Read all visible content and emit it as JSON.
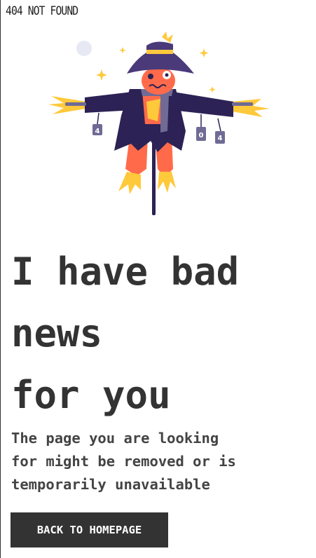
{
  "header": {
    "title": "404 NOT FOUND"
  },
  "hero": {
    "headline_lines": [
      "I have bad",
      "news",
      "for you"
    ],
    "message_lines": [
      "The page you are looking",
      "for might be removed or is",
      "temporarily unavailable"
    ],
    "sign_letters": [
      "4",
      "0",
      "4"
    ]
  },
  "actions": {
    "back_label": "BACK TO HOMEPAGE"
  },
  "colors": {
    "text": "#333333",
    "button_bg": "#333333",
    "button_text": "#ffffff",
    "scarecrow_coat": "#2c2255",
    "scarecrow_body": "#ff6b4a",
    "hat": "#4a3a7a",
    "straw": "#ffc93c"
  }
}
